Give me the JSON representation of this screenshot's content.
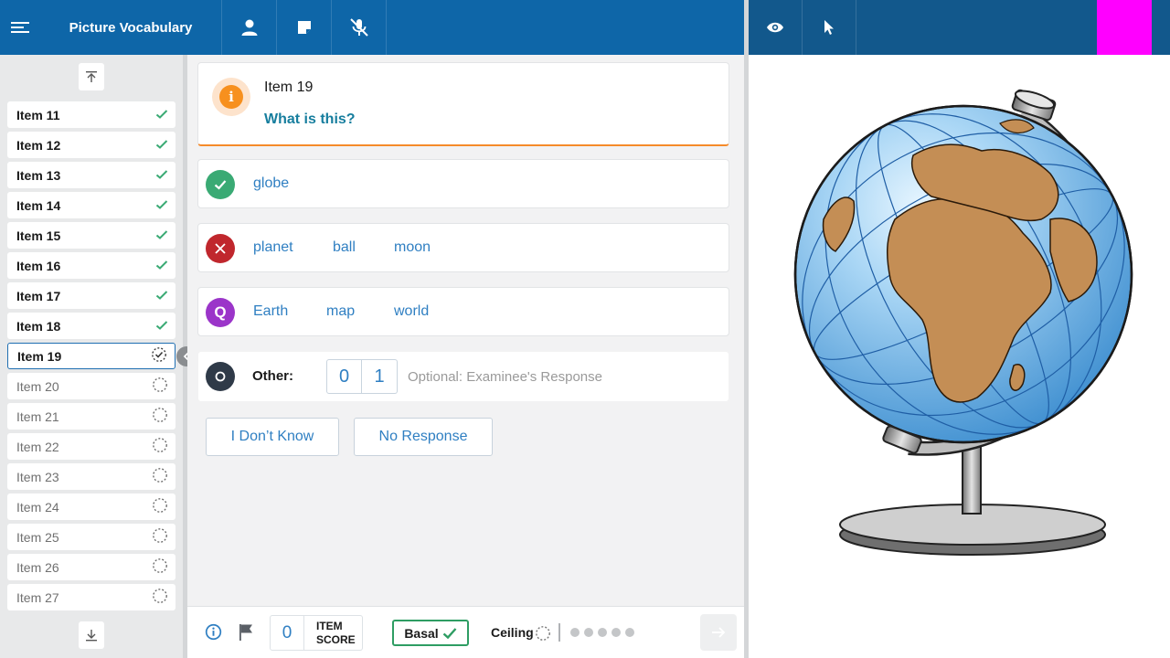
{
  "app": {
    "title": "Picture Vocabulary",
    "toolbar_icons": [
      "menu-icon",
      "person-icon",
      "note-icon",
      "mic-off-icon"
    ],
    "right_toolbar_icons": [
      "eye-icon",
      "pointer-icon"
    ],
    "accent_color": "#ff00ff"
  },
  "sidebar": {
    "items": [
      {
        "label": "Item 11",
        "status": "done"
      },
      {
        "label": "Item 12",
        "status": "done"
      },
      {
        "label": "Item 13",
        "status": "done"
      },
      {
        "label": "Item 14",
        "status": "done"
      },
      {
        "label": "Item 15",
        "status": "done"
      },
      {
        "label": "Item 16",
        "status": "done"
      },
      {
        "label": "Item 17",
        "status": "done"
      },
      {
        "label": "Item 18",
        "status": "done"
      },
      {
        "label": "Item 19",
        "status": "current"
      },
      {
        "label": "Item 20",
        "status": "pending"
      },
      {
        "label": "Item 21",
        "status": "pending"
      },
      {
        "label": "Item 22",
        "status": "pending"
      },
      {
        "label": "Item 23",
        "status": "pending"
      },
      {
        "label": "Item 24",
        "status": "pending"
      },
      {
        "label": "Item 25",
        "status": "pending"
      },
      {
        "label": "Item 26",
        "status": "pending"
      },
      {
        "label": "Item 27",
        "status": "pending"
      }
    ]
  },
  "question": {
    "title": "Item 19",
    "prompt": "What is this?"
  },
  "responses": {
    "correct": [
      "globe"
    ],
    "incorrect": [
      "planet",
      "ball",
      "moon"
    ],
    "query": [
      "Earth",
      "map",
      "world"
    ]
  },
  "other": {
    "label": "Other:",
    "score_options": [
      "0",
      "1"
    ],
    "placeholder": "Optional: Examinee's Response"
  },
  "buttons": {
    "dont_know": "I Don’t Know",
    "no_response": "No Response"
  },
  "footer": {
    "item_score": "0",
    "item_score_label_1": "ITEM",
    "item_score_label_2": "SCORE",
    "basal_label": "Basal",
    "ceiling_label": "Ceiling",
    "ceiling_dots": 5
  },
  "colors": {
    "correct": "#3aaa74",
    "incorrect": "#c0272d",
    "query": "#9b35c9",
    "other": "#2f3a48"
  }
}
